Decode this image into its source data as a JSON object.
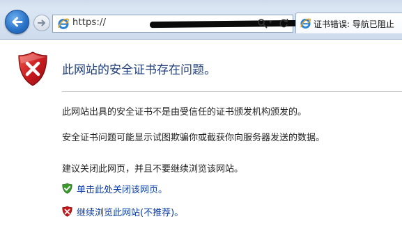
{
  "browser": {
    "address_url": "https://",
    "tab_title": "证书错误: 导航已阻止"
  },
  "page": {
    "title": "此网站的安全证书存在问题。",
    "paragraph1": "此网站出具的安全证书不是由受信任的证书颁发机构颁发的。",
    "paragraph2": "安全证书问题可能显示试图欺骗你或截获你向服务器发送的数据。",
    "paragraph3": "建议关闭此网页，并且不要继续浏览该网站。",
    "link_close": "单击此处关闭该网页。",
    "link_continue": "继续浏览此网站(不推荐)。"
  },
  "icons": {
    "back": "back-arrow-icon",
    "forward": "forward-arrow-icon",
    "ie": "ie-logo-icon",
    "search": "search-icon",
    "refresh": "refresh-icon",
    "shield_error": "shield-error-icon",
    "shield_ok": "shield-check-icon"
  },
  "colors": {
    "title": "#1f3d7a",
    "link": "#0b3aa6",
    "shield_red": "#c8191c",
    "shield_green": "#3a9a2a"
  }
}
